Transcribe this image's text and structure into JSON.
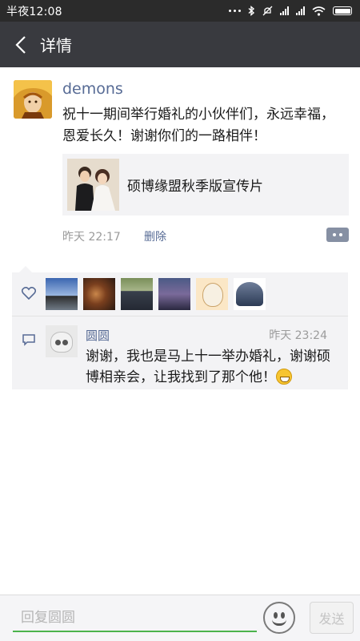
{
  "status_bar": {
    "time": "半夜12:08"
  },
  "nav": {
    "title": "详情"
  },
  "post": {
    "author": "demons",
    "text": "祝十一期间举行婚礼的小伙伴们，永远幸福，恩爱长久！谢谢你们的一路相伴！",
    "link_title": "硕博缘盟秋季版宣传片",
    "time": "昨天 22:17",
    "delete_label": "删除"
  },
  "comment": {
    "author": "圆圆",
    "time": "昨天 23:24",
    "text": "谢谢，我也是马上十一举办婚礼，谢谢硕博相亲会，让我找到了那个他！"
  },
  "reply": {
    "placeholder": "回复圆圆",
    "send_label": "发送"
  },
  "colors": {
    "nav_bg": "#393a3f",
    "link_blue": "#576b95",
    "input_green": "#4cb34c"
  }
}
